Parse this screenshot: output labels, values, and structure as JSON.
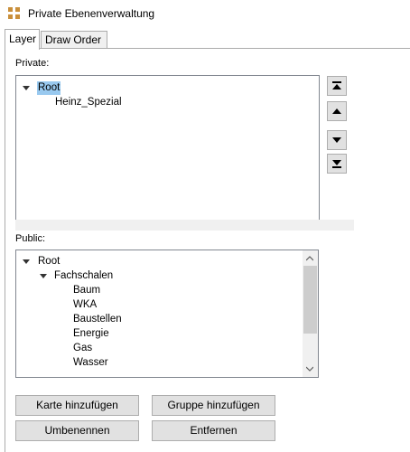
{
  "window": {
    "title": "Private Ebenenverwaltung",
    "icon": "app-grid-icon",
    "accent": "#c98f3b"
  },
  "tabs": [
    {
      "label": "Layer",
      "active": true
    },
    {
      "label": "Draw Order",
      "active": false
    }
  ],
  "private_section": {
    "label": "Private:",
    "tree": {
      "root": "Root",
      "children": [
        "Heinz_Spezial"
      ]
    },
    "selected": "Root",
    "selection_color": "#99c9ef"
  },
  "order_buttons": [
    {
      "icon": "move-to-top-icon"
    },
    {
      "icon": "move-up-icon"
    },
    {
      "icon": "move-down-icon"
    },
    {
      "icon": "move-to-bottom-icon"
    }
  ],
  "public_section": {
    "label": "Public:",
    "tree": {
      "root": "Root",
      "group": "Fachschalen",
      "children": [
        "Baum",
        "WKA",
        "Baustellen",
        "Energie",
        "Gas",
        "Wasser"
      ]
    }
  },
  "buttons": {
    "add_map": "Karte hinzufügen",
    "add_group": "Gruppe hinzufügen",
    "rename": "Umbenennen",
    "remove": "Entfernen"
  }
}
